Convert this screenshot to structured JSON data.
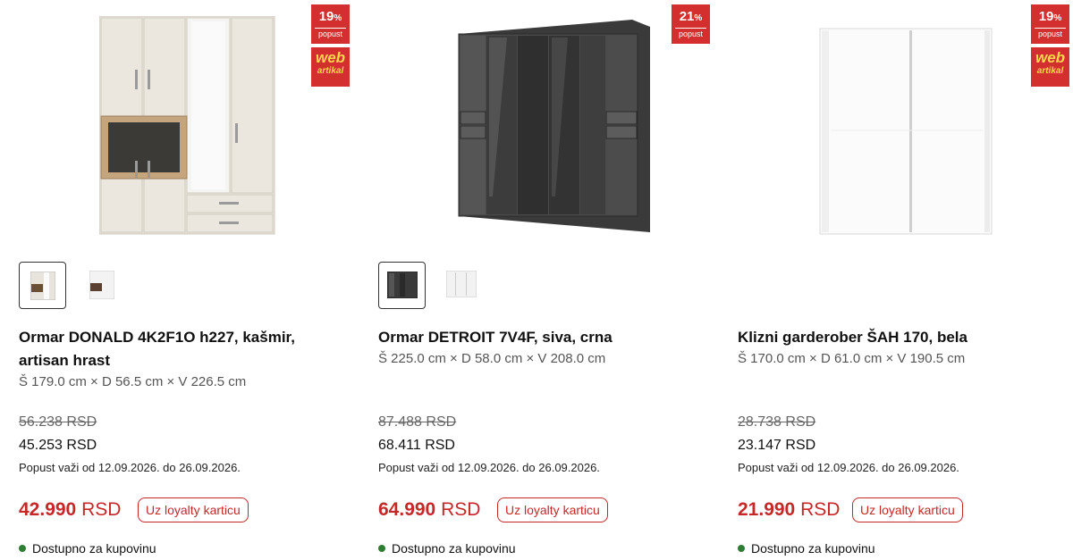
{
  "products": [
    {
      "badge": {
        "percent": "19",
        "percent_sign": "%",
        "label": "popust"
      },
      "web_badge": {
        "line1": "web",
        "line2": "artikal"
      },
      "image_icon": "wardrobe-cashmere-oak-image",
      "title": "Ormar DONALD 4K2F1O h227, kašmir, artisan hrast",
      "dimensions": "Š 179.0 cm × D 56.5 cm × V 226.5 cm",
      "old_price": "56.238 RSD",
      "regular_price": "45.253 RSD",
      "validity": "Popust važi od 12.09.2026. do 26.09.2026.",
      "loyalty_amount": "42.990",
      "loyalty_currency": "RSD",
      "loyalty_label": "Uz loyalty karticu",
      "availability": "Dostupno za kupovinu",
      "availability_color": "#2e7d32"
    },
    {
      "badge": {
        "percent": "21",
        "percent_sign": "%",
        "label": "popust"
      },
      "image_icon": "wardrobe-grey-black-image",
      "title": "Ormar DETROIT 7V4F, siva, crna",
      "dimensions": "Š 225.0 cm × D 58.0 cm × V 208.0 cm",
      "old_price": "87.488 RSD",
      "regular_price": "68.411 RSD",
      "validity": "Popust važi od 12.09.2026. do 26.09.2026.",
      "loyalty_amount": "64.990",
      "loyalty_currency": "RSD",
      "loyalty_label": "Uz loyalty karticu",
      "availability": "Dostupno za kupovinu",
      "availability_color": "#2e7d32"
    },
    {
      "badge": {
        "percent": "19",
        "percent_sign": "%",
        "label": "popust"
      },
      "web_badge": {
        "line1": "web",
        "line2": "artikal"
      },
      "image_icon": "sliding-wardrobe-white-image",
      "title": "Klizni garderober ŠAH 170, bela",
      "dimensions": "Š 170.0 cm × D 61.0 cm × V 190.5 cm",
      "old_price": "28.738 RSD",
      "regular_price": "23.147 RSD",
      "validity": "Popust važi od 12.09.2026. do 26.09.2026.",
      "loyalty_amount": "21.990",
      "loyalty_currency": "RSD",
      "loyalty_label": "Uz loyalty karticu",
      "availability": "Dostupno za kupovinu",
      "availability_color": "#2e7d32"
    }
  ],
  "colors": {
    "accent": "#c62828",
    "badge": "#d32f2f",
    "web_badge_text": "#ffd54f"
  }
}
